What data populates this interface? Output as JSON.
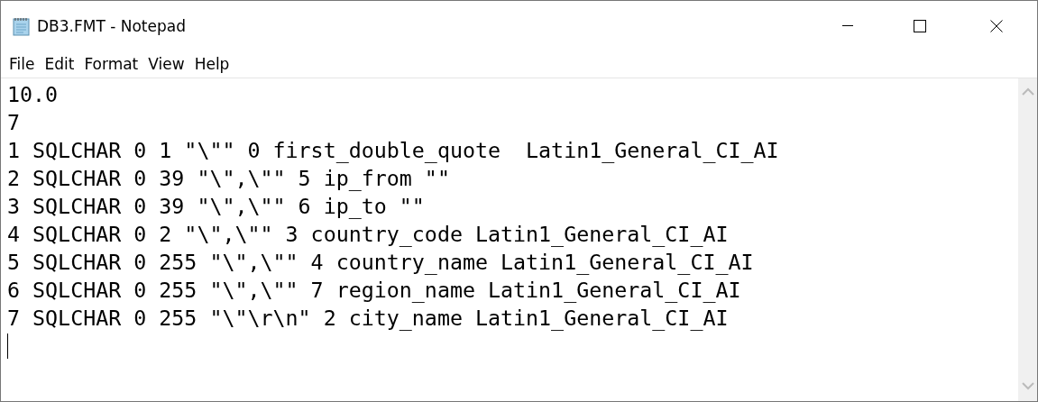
{
  "window": {
    "title": "DB3.FMT - Notepad"
  },
  "menu": [
    "File",
    "Edit",
    "Format",
    "View",
    "Help"
  ],
  "editor": {
    "lines": [
      "10.0",
      "7",
      "1 SQLCHAR 0 1 \"\\\"\" 0 first_double_quote  Latin1_General_CI_AI",
      "2 SQLCHAR 0 39 \"\\\",\\\"\" 5 ip_from \"\"",
      "3 SQLCHAR 0 39 \"\\\",\\\"\" 6 ip_to \"\"",
      "4 SQLCHAR 0 2 \"\\\",\\\"\" 3 country_code Latin1_General_CI_AI",
      "5 SQLCHAR 0 255 \"\\\",\\\"\" 4 country_name Latin1_General_CI_AI",
      "6 SQLCHAR 0 255 \"\\\",\\\"\" 7 region_name Latin1_General_CI_AI",
      "7 SQLCHAR 0 255 \"\\\"\\r\\n\" 2 city_name Latin1_General_CI_AI"
    ]
  }
}
